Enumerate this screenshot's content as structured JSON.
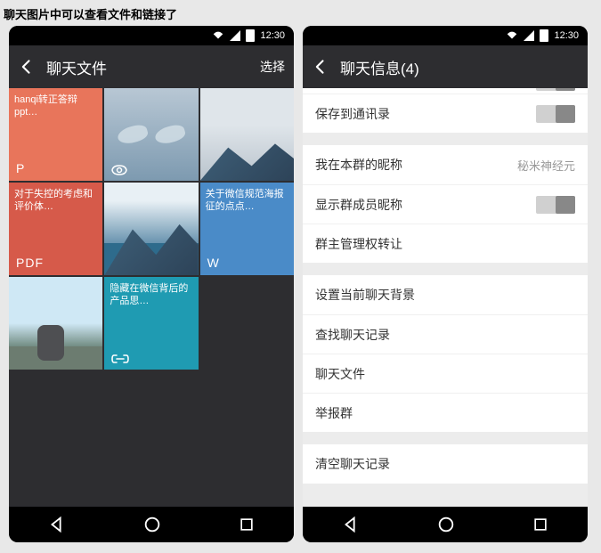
{
  "page_caption": "聊天图片中可以查看文件和链接了",
  "status": {
    "time": "12:30"
  },
  "left": {
    "appbar_title": "聊天文件",
    "appbar_action": "选择",
    "tiles": {
      "t0_caption": "hanqi转正答辩ppt…",
      "t0_badge": "P",
      "t3_caption": "对于失控的考虑和评价体…",
      "t3_badge": "PDF",
      "t5_caption": "关于微信规范海报征的点点…",
      "t5_badge": "W",
      "t7_caption": "隐藏在微信背后的产品思…"
    }
  },
  "right": {
    "appbar_title": "聊天信息(4)",
    "rows": {
      "save_contacts": "保存到通讯录",
      "my_nick": "我在本群的昵称",
      "my_nick_value": "秘米神经元",
      "show_nick": "显示群成员昵称",
      "transfer_admin": "群主管理权转让",
      "set_bg": "设置当前聊天背景",
      "search_history": "查找聊天记录",
      "chat_files": "聊天文件",
      "report": "举报群",
      "clear_history": "清空聊天记录"
    }
  }
}
